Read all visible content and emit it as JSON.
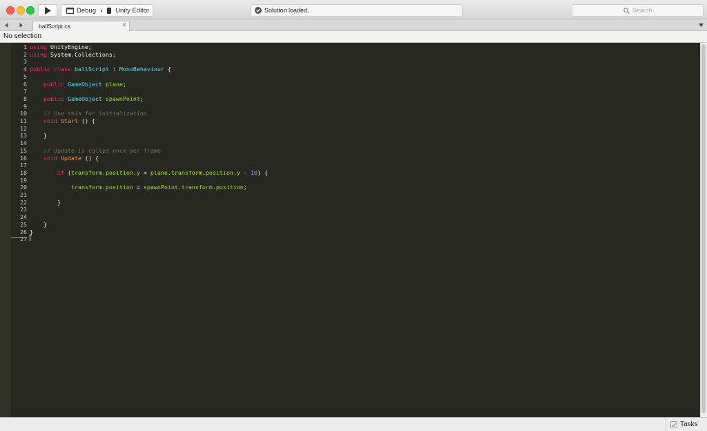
{
  "toolbar": {
    "configuration": "Debug",
    "separator": "›",
    "target": "Unity Editor",
    "status": "Solution loaded.",
    "search_placeholder": "Search"
  },
  "tab": {
    "filename": "ballScript.cs",
    "close_glyph": "×"
  },
  "pathbar": {
    "selection": "No selection"
  },
  "statusbar": {
    "tasks_label": "Tasks"
  },
  "colors": {
    "editor_bg": "#272822",
    "keyword": "#f92672",
    "type": "#66d9ef",
    "method": "#fd971f",
    "identifier": "#a6e22e",
    "comment": "#75715e",
    "number": "#ae81ff"
  },
  "icons": [
    "play-icon",
    "window-icon",
    "device-icon",
    "checkmark-circle-icon",
    "search-icon",
    "back-arrow-icon",
    "forward-arrow-icon",
    "close-icon",
    "chevron-down-icon",
    "checkbox-icon"
  ],
  "code_lines": [
    {
      "n": "1",
      "tokens": [
        {
          "t": "using",
          "c": "kw"
        },
        {
          "t": " UnityEngine;",
          "c": "pl"
        }
      ]
    },
    {
      "n": "2",
      "tokens": [
        {
          "t": "using",
          "c": "kw"
        },
        {
          "t": " System.Collections;",
          "c": "pl"
        }
      ]
    },
    {
      "n": "3",
      "tokens": []
    },
    {
      "n": "4",
      "tokens": [
        {
          "t": "public class",
          "c": "kw"
        },
        {
          "t": " ",
          "c": "pl"
        },
        {
          "t": "ballScript",
          "c": "ty"
        },
        {
          "t": " : ",
          "c": "pl"
        },
        {
          "t": "MonoBehaviour",
          "c": "ty"
        },
        {
          "t": " {",
          "c": "pl"
        }
      ]
    },
    {
      "n": "5",
      "tokens": []
    },
    {
      "n": "6",
      "tokens": [
        {
          "t": "    ",
          "c": "pl"
        },
        {
          "t": "public",
          "c": "kw"
        },
        {
          "t": " ",
          "c": "pl"
        },
        {
          "t": "GameObject",
          "c": "ty"
        },
        {
          "t": " ",
          "c": "pl"
        },
        {
          "t": "plane",
          "c": "id"
        },
        {
          "t": ";",
          "c": "pl"
        }
      ]
    },
    {
      "n": "7",
      "tokens": []
    },
    {
      "n": "8",
      "tokens": [
        {
          "t": "    ",
          "c": "pl"
        },
        {
          "t": "public",
          "c": "kw"
        },
        {
          "t": " ",
          "c": "pl"
        },
        {
          "t": "GameObject",
          "c": "ty"
        },
        {
          "t": " ",
          "c": "pl"
        },
        {
          "t": "spawnPoint",
          "c": "id"
        },
        {
          "t": ";",
          "c": "pl"
        }
      ]
    },
    {
      "n": "9",
      "tokens": []
    },
    {
      "n": "10",
      "tokens": [
        {
          "t": "    // Use this for initialization",
          "c": "cm"
        }
      ]
    },
    {
      "n": "11",
      "tokens": [
        {
          "t": "    ",
          "c": "pl"
        },
        {
          "t": "void",
          "c": "kw"
        },
        {
          "t": " ",
          "c": "pl"
        },
        {
          "t": "Start",
          "c": "fn"
        },
        {
          "t": " () {",
          "c": "pl"
        }
      ]
    },
    {
      "n": "12",
      "tokens": []
    },
    {
      "n": "13",
      "tokens": [
        {
          "t": "    }",
          "c": "pl"
        }
      ]
    },
    {
      "n": "14",
      "tokens": []
    },
    {
      "n": "15",
      "tokens": [
        {
          "t": "    // Update is called once per frame",
          "c": "cm"
        }
      ]
    },
    {
      "n": "16",
      "tokens": [
        {
          "t": "    ",
          "c": "pl"
        },
        {
          "t": "void",
          "c": "kw"
        },
        {
          "t": " ",
          "c": "pl"
        },
        {
          "t": "Update",
          "c": "fn"
        },
        {
          "t": " () {",
          "c": "pl"
        }
      ]
    },
    {
      "n": "17",
      "tokens": []
    },
    {
      "n": "18",
      "tokens": [
        {
          "t": "        ",
          "c": "pl"
        },
        {
          "t": "if",
          "c": "kw"
        },
        {
          "t": " (",
          "c": "pl"
        },
        {
          "t": "transform",
          "c": "id"
        },
        {
          "t": ".",
          "c": "pl"
        },
        {
          "t": "position",
          "c": "id"
        },
        {
          "t": ".",
          "c": "pl"
        },
        {
          "t": "y",
          "c": "id"
        },
        {
          "t": " < ",
          "c": "pl"
        },
        {
          "t": "plane",
          "c": "id"
        },
        {
          "t": ".",
          "c": "pl"
        },
        {
          "t": "transform",
          "c": "id"
        },
        {
          "t": ".",
          "c": "pl"
        },
        {
          "t": "position",
          "c": "id"
        },
        {
          "t": ".",
          "c": "pl"
        },
        {
          "t": "y",
          "c": "id"
        },
        {
          "t": " - ",
          "c": "pl"
        },
        {
          "t": "10",
          "c": "nm"
        },
        {
          "t": ") {",
          "c": "pl"
        }
      ]
    },
    {
      "n": "19",
      "tokens": []
    },
    {
      "n": "20",
      "tokens": [
        {
          "t": "            ",
          "c": "pl"
        },
        {
          "t": "transform",
          "c": "id"
        },
        {
          "t": ".",
          "c": "pl"
        },
        {
          "t": "position",
          "c": "id"
        },
        {
          "t": " = ",
          "c": "pl"
        },
        {
          "t": "spawnPoint",
          "c": "id"
        },
        {
          "t": ".",
          "c": "pl"
        },
        {
          "t": "transform",
          "c": "id"
        },
        {
          "t": ".",
          "c": "pl"
        },
        {
          "t": "position",
          "c": "id"
        },
        {
          "t": ";",
          "c": "pl"
        }
      ]
    },
    {
      "n": "21",
      "tokens": []
    },
    {
      "n": "22",
      "tokens": [
        {
          "t": "        }",
          "c": "pl"
        }
      ]
    },
    {
      "n": "23",
      "tokens": []
    },
    {
      "n": "24",
      "tokens": []
    },
    {
      "n": "25",
      "tokens": [
        {
          "t": "    }",
          "c": "pl"
        }
      ]
    },
    {
      "n": "26",
      "tokens": [
        {
          "t": "}",
          "c": "pl"
        }
      ]
    },
    {
      "n": "27",
      "tokens": []
    }
  ]
}
